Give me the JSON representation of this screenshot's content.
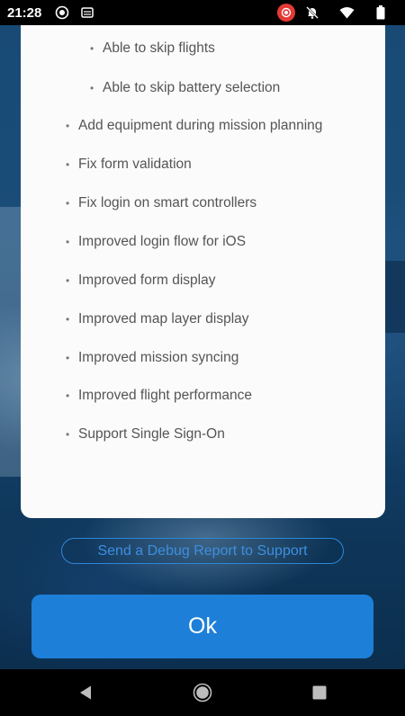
{
  "status_bar": {
    "time": "21:28",
    "left_icons": [
      "record-status-icon",
      "sd-card-icon"
    ],
    "right_icons": [
      "screen-record-icon",
      "notifications-off-icon",
      "wifi-icon",
      "battery-icon"
    ]
  },
  "release_notes": {
    "items": [
      {
        "text": "Able to skip flights",
        "level": "sub"
      },
      {
        "text": "Able to skip battery selection",
        "level": "sub"
      },
      {
        "text": "Add equipment during mission planning",
        "level": "main"
      },
      {
        "text": "Fix form validation",
        "level": "main"
      },
      {
        "text": "Fix login on smart controllers",
        "level": "main"
      },
      {
        "text": "Improved login flow for iOS",
        "level": "main"
      },
      {
        "text": "Improved form display",
        "level": "main"
      },
      {
        "text": "Improved map layer display",
        "level": "main"
      },
      {
        "text": "Improved mission syncing",
        "level": "main"
      },
      {
        "text": "Improved flight performance",
        "level": "main"
      },
      {
        "text": "Support Single Sign-On",
        "level": "main"
      }
    ]
  },
  "actions": {
    "debug_label": "Send a Debug Report to Support",
    "ok_label": "Ok"
  },
  "nav_bar": {
    "icons": [
      "back-icon",
      "home-icon",
      "recents-icon"
    ]
  },
  "colors": {
    "accent": "#1e7fd8",
    "link": "#3d8fe0",
    "card": "#fbfbfb",
    "background": "#174a74"
  }
}
